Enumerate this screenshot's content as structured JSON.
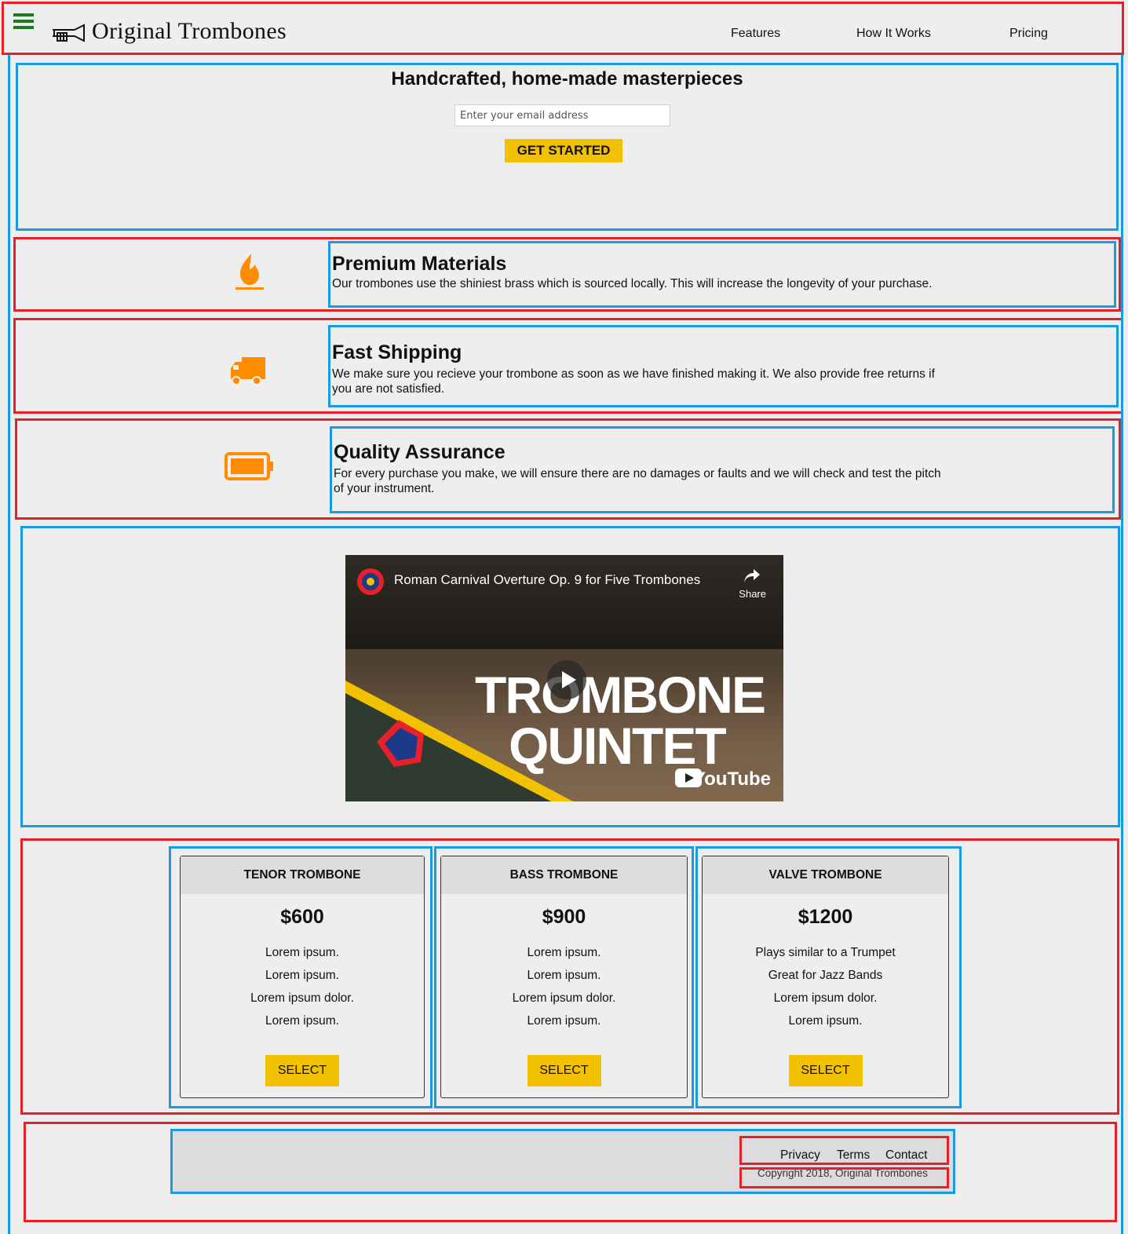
{
  "brand": {
    "name": "Original Trombones",
    "accent_color": "#f2c200",
    "icon_color": "#ff8c00",
    "menu_icon_color": "#1b7a1b"
  },
  "nav": {
    "links": [
      "Features",
      "How It Works",
      "Pricing"
    ]
  },
  "hero": {
    "title": "Handcrafted, home-made masterpieces",
    "email_placeholder": "Enter your email address",
    "cta_label": "GET STARTED"
  },
  "features": [
    {
      "icon": "fire-icon",
      "title": "Premium Materials",
      "text": "Our trombones use the shiniest brass which is sourced locally. This will increase the longevity of your purchase."
    },
    {
      "icon": "truck-icon",
      "title": "Fast Shipping",
      "text": "We make sure you recieve your trombone as soon as we have finished making it. We also provide free returns if you are not satisfied."
    },
    {
      "icon": "battery-icon",
      "title": "Quality Assurance",
      "text": "For every purchase you make, we will ensure there are no damages or faults and we will check and test the pitch of your instrument."
    }
  ],
  "video": {
    "title": "Roman Carnival Overture Op. 9 for Five Trombones",
    "share_label": "Share",
    "overlay_line1": "TROMBONE",
    "overlay_line2": "QUINTET",
    "platform_label": "YouTube"
  },
  "pricing": {
    "select_label": "SELECT",
    "plans": [
      {
        "name": "TENOR TROMBONE",
        "price": "$600",
        "features": [
          "Lorem ipsum.",
          "Lorem ipsum.",
          "Lorem ipsum dolor.",
          "Lorem ipsum."
        ]
      },
      {
        "name": "BASS TROMBONE",
        "price": "$900",
        "features": [
          "Lorem ipsum.",
          "Lorem ipsum.",
          "Lorem ipsum dolor.",
          "Lorem ipsum."
        ]
      },
      {
        "name": "VALVE TROMBONE",
        "price": "$1200",
        "features": [
          "Plays similar to a Trumpet",
          "Great for Jazz Bands",
          "Lorem ipsum dolor.",
          "Lorem ipsum."
        ]
      }
    ]
  },
  "footer": {
    "links": [
      "Privacy",
      "Terms",
      "Contact"
    ],
    "copyright": "Copyright 2018, Original Trombones"
  }
}
